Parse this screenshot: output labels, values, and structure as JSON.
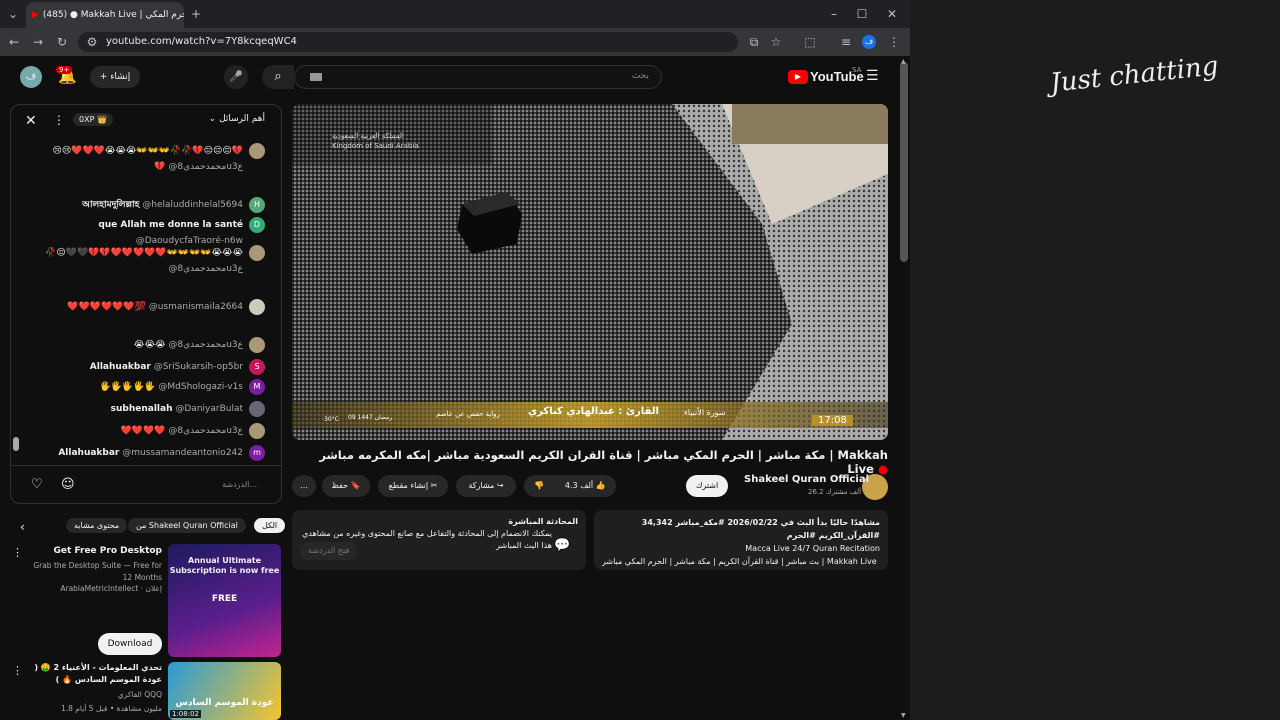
{
  "browser": {
    "tab_title": "(485) ● Makkah Live | الحرم المكي",
    "url": "youtube.com/watch?v=7Y8kcqeqWC4"
  },
  "yt": {
    "logo": "YouTube",
    "region": "SA",
    "search_placeholder": "بحث",
    "create": "إنشاء",
    "notif_count": "9+",
    "avatar": "ف"
  },
  "chat": {
    "header": "أهم الرسائل",
    "xp": "0XP",
    "placeholder": "الدردشة...",
    "messages": [
      {
        "author": "@محمدحمدي8u3ع",
        "text": "😢😢❤️❤️❤️😭😭😭👐👐👐🥀🥀💔😔😔😔💔💔",
        "color": "#a97"
      },
      {
        "author": "@helaluddinhelal5694",
        "text": "আলহামদুলিল্লাহ",
        "color": "#5a7",
        "initial": "H"
      },
      {
        "author": "@DaoudycfaTraoré-n6w",
        "text": "que Allah me donne la santé",
        "color": "#3a7",
        "initial": "D"
      },
      {
        "author": "@محمدحمدي8u3ع",
        "text": "🥀😔🖤🖤💔💔❤️❤️❤️❤️❤️👐👐👐👐😭😭😭",
        "color": "#a97"
      },
      {
        "author": "@usmanismaila2664",
        "text": "❤️❤️❤️❤️❤️❤️💯",
        "color": "#ccb"
      },
      {
        "author": "@محمدحمدي8u3ع",
        "text": "😭😭😭",
        "color": "#a97"
      },
      {
        "author": "@SriSukarsih-op5br",
        "text": "Allahuakbar",
        "color": "#c2185b",
        "initial": "S"
      },
      {
        "author": "@MdShologazi-v1s",
        "text": "🖐️🖐️🖐️🖐️🖐️",
        "color": "#7b1fa2",
        "initial": "M"
      },
      {
        "author": "@DaniyarBulat",
        "text": "subhenallah",
        "color": "#667"
      },
      {
        "author": "@محمدحمدي8u3ع",
        "text": "❤️❤️❤️❤️",
        "color": "#a97"
      },
      {
        "author": "@mussamandeantonio242",
        "text": "Allahuakbar",
        "color": "#7b1fa2",
        "initial": "m"
      }
    ]
  },
  "video": {
    "overlay_reader": "القارئ : عبدالهادي كناكري",
    "overlay_surah": "سورة الأنبياء",
    "overlay_time": "17:08",
    "overlay_temp": "30°C",
    "overlay_riwaya": "رواية حفص عن عاصم",
    "overlay_date": "09 رمضان 1447",
    "overlay_brand": "المملكة العربية السعودية",
    "overlay_brand_en": "Kingdom of Saudi Arabia",
    "title": "مكة مباشر | الحرم المكي مباشر | قناة القران الكريم السعودية مباشر |مكه المكرمه مباشر | Makkah Live",
    "channel": "Shakeel Quran Official",
    "subs": "26.2 ألف مشترك",
    "join": "اشترك",
    "likes": "4.3 ألف",
    "share": "مشاركة",
    "clip": "إنشاء مقطع",
    "save": "حفظ",
    "more": "..."
  },
  "desc": {
    "stats": "34,342 مشاهدًا حاليًا  بدأ البث في 2026/02/22  #مكة_مباشر #القرآن_الكريم #الحرم",
    "line2": "Macca Live 24/7 Quran Recitation",
    "line3": "بث مباشر | قناة القرآن الكريم | مكة مباشر | الحرم المكي مباشر | Makkah Live ...المزيد"
  },
  "livechat_card": {
    "title": "المحادثة المباشرة",
    "text": "يمكنك الانضمام إلى المحادثة والتفاعل مع صانع المحتوى وغيره من مشاهدي هذا البث المباشر",
    "btn": "فتح الدردشة"
  },
  "rec": {
    "chips": [
      "الكل",
      "من Shakeel Quran Official",
      "محتوى مشابه"
    ],
    "ad_title": "Get Free Pro Desktop",
    "ad_desc": "Grab the Desktop Suite — Free for 12 Months",
    "ad_source": "ArabiaMetricIntellect · إعلان",
    "ad_thumb_title": "Annual Ultimate Subscription is now free",
    "ad_thumb_free": "FREE",
    "download": "Download",
    "v2_title": "تحدي المعلومات - الأعنياء 2 🤑 ( عودة الموسم السادس 🔥 )",
    "v2_channel": "الفاكري QQQ",
    "v2_meta": "1.8 مليون مشاهدة • قبل 5 أيام",
    "v2_duration": "1:08:02",
    "v2_thumb": "عودة الموسم السادس"
  },
  "right": {
    "logo_text": "Just chatting"
  }
}
